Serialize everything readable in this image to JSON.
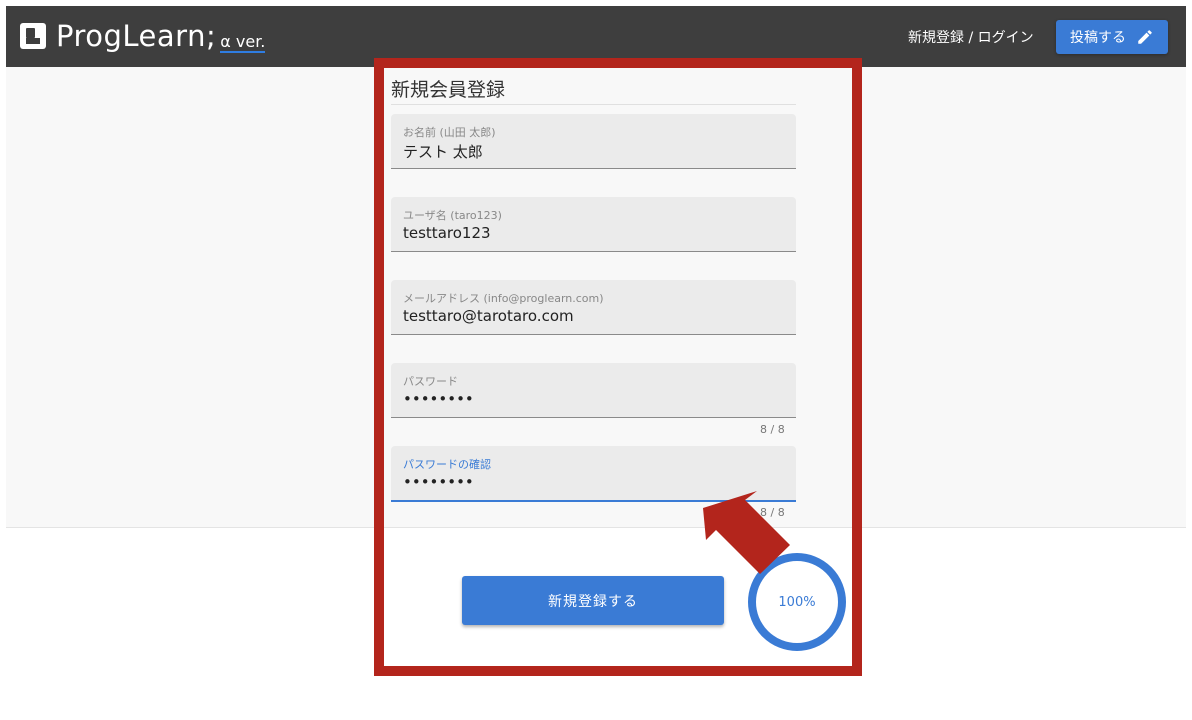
{
  "header": {
    "logo_text": "ProgLearn;",
    "logo_sub": "α ver.",
    "auth_link": "新規登録 / ログイン",
    "post_button": "投稿する"
  },
  "form": {
    "title": "新規会員登録",
    "fields": [
      {
        "label": "お名前 (山田 太郎)",
        "value": "テスト 太郎"
      },
      {
        "label": "ユーザ名 (taro123)",
        "value": "testtaro123"
      },
      {
        "label": "メールアドレス (info@proglearn.com)",
        "value": "testtaro@tarotaro.com"
      },
      {
        "label": "パスワード",
        "value": "••••••••",
        "counter": "8 / 8"
      },
      {
        "label": "パスワードの確認",
        "value": "••••••••",
        "counter": "8 / 8"
      }
    ],
    "submit_button": "新規登録する"
  },
  "progress": {
    "label": "100%",
    "value": 100
  },
  "colors": {
    "header_bg": "#3e3e3e",
    "accent": "#3a7bd5",
    "highlight": "#b3251c"
  },
  "icons": [
    "logo-icon",
    "pencil-icon",
    "arrow-annotation"
  ]
}
